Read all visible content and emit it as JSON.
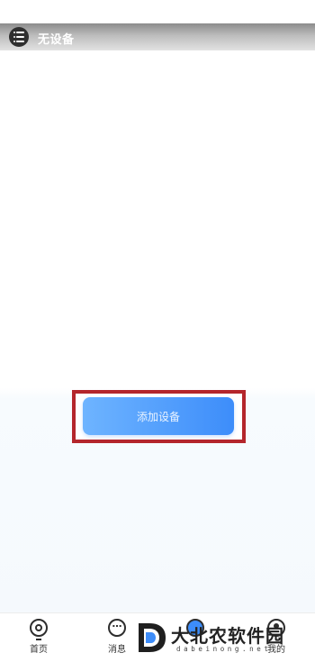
{
  "header": {
    "title": "无设备"
  },
  "main": {
    "add_device_label": "添加设备"
  },
  "tabbar": {
    "items": [
      {
        "label": "首页",
        "icon": "home-icon"
      },
      {
        "label": "消息",
        "icon": "message-icon"
      },
      {
        "label": "",
        "icon": "center-icon"
      },
      {
        "label": "我的",
        "icon": "profile-icon"
      }
    ]
  },
  "watermark": {
    "brand": "大北农软件园",
    "url": "dabeinong.net"
  },
  "colors": {
    "accent": "#3d8dfa",
    "highlight_border": "#b4262c"
  }
}
